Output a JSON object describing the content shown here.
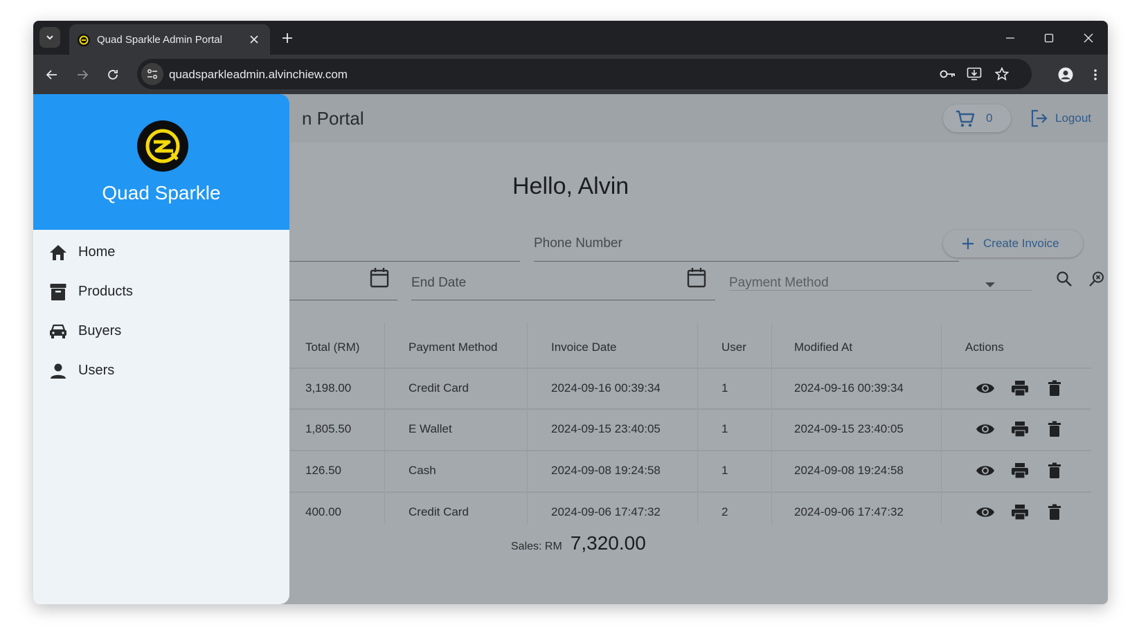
{
  "browser": {
    "tab_title": "Quad Sparkle Admin Portal",
    "url": "quadsparkleadmin.alvinchiew.com"
  },
  "topbar": {
    "portal_title": "n Portal",
    "cart_count": "0",
    "logout_label": "Logout"
  },
  "main": {
    "greeting": "Hello, Alvin",
    "phone_label": "Phone Number",
    "create_invoice_label": "Create Invoice",
    "end_date_label": "End Date",
    "payment_method_label": "Payment Method"
  },
  "table": {
    "headers": {
      "total": "Total (RM)",
      "payment_method": "Payment Method",
      "invoice_date": "Invoice Date",
      "user": "User",
      "modified_at": "Modified At",
      "actions": "Actions"
    },
    "rows": [
      {
        "total": "3,198.00",
        "payment_method": "Credit Card",
        "invoice_date": "2024-09-16 00:39:34",
        "user": "1",
        "modified_at": "2024-09-16 00:39:34"
      },
      {
        "total": "1,805.50",
        "payment_method": "E Wallet",
        "invoice_date": "2024-09-15 23:40:05",
        "user": "1",
        "modified_at": "2024-09-15 23:40:05"
      },
      {
        "total": "126.50",
        "payment_method": "Cash",
        "invoice_date": "2024-09-08 19:24:58",
        "user": "1",
        "modified_at": "2024-09-08 19:24:58"
      },
      {
        "total": "400.00",
        "payment_method": "Credit Card",
        "invoice_date": "2024-09-06 17:47:32",
        "user": "2",
        "modified_at": "2024-09-06 17:47:32"
      }
    ]
  },
  "sales": {
    "label": "Sales: RM",
    "amount": "7,320.00"
  },
  "drawer": {
    "brand_name": "Quad Sparkle",
    "items": [
      {
        "label": "Home",
        "icon": "home-icon"
      },
      {
        "label": "Products",
        "icon": "archive-box-icon"
      },
      {
        "label": "Buyers",
        "icon": "car-icon"
      },
      {
        "label": "Users",
        "icon": "person-icon"
      }
    ]
  },
  "colors": {
    "drawer_header": "#2196f3",
    "accent_text": "#2f5b8d",
    "overlay_page": "#a4a9ad",
    "drawer_bg": "#eef3f7"
  }
}
